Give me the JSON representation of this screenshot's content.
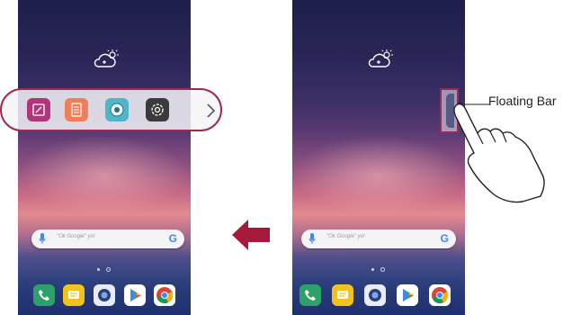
{
  "colors": {
    "accent_red": "#9e2a4f",
    "arrow_red": "#a8183a"
  },
  "left_phone": {
    "weather_icon": "cloud-sun-icon",
    "floating_bar_apps": [
      {
        "icon": "notepad-icon",
        "color": "#b0357a"
      },
      {
        "icon": "notes-list-icon",
        "color": "#ee7f57"
      },
      {
        "icon": "camera-capture-icon",
        "color": "#4fb6c8"
      },
      {
        "icon": "settings-icon",
        "color": "#3b3b3d"
      }
    ],
    "chevron_icon": "chevron-right-icon",
    "search": {
      "hint": "\"Ok Google\" yo!",
      "g_label": "G"
    },
    "dock": [
      "phone-icon",
      "messages-icon",
      "camera-icon",
      "play-store-icon",
      "chrome-icon"
    ]
  },
  "right_phone": {
    "weather_icon": "cloud-sun-icon",
    "search": {
      "hint": "\"Ok Google\" yo!",
      "g_label": "G"
    },
    "dock": [
      "phone-icon",
      "messages-icon",
      "camera-icon",
      "play-store-icon",
      "chrome-icon"
    ]
  },
  "callout": {
    "label": "Floating Bar"
  }
}
